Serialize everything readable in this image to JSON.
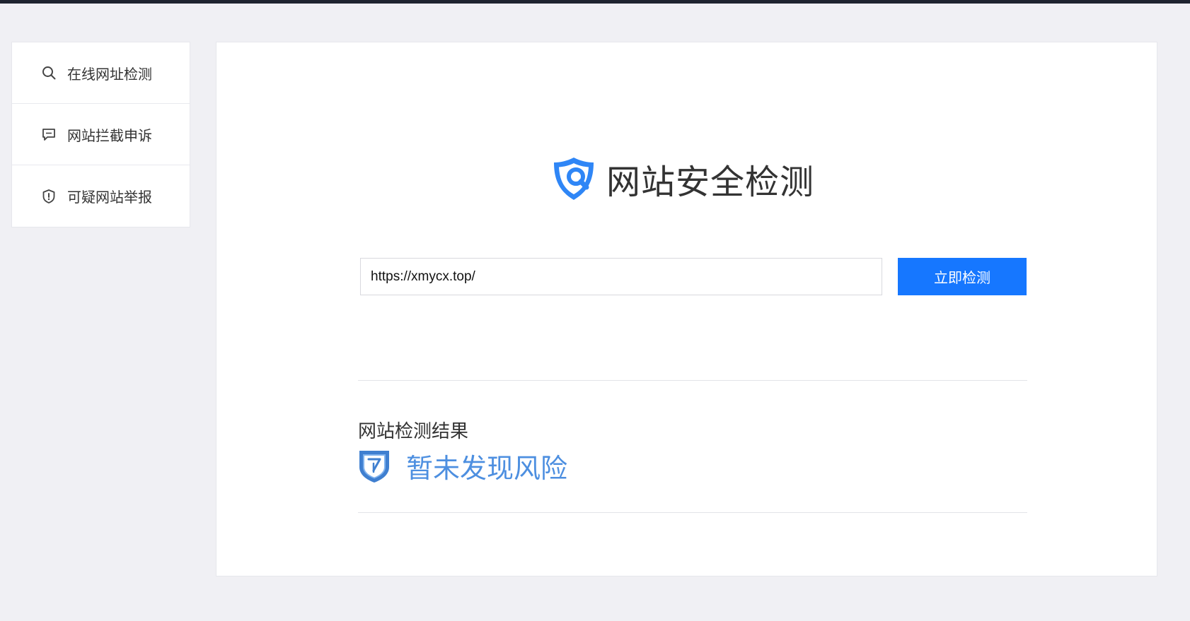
{
  "sidebar": {
    "items": [
      {
        "label": "在线网址检测",
        "icon": "search-icon"
      },
      {
        "label": "网站拦截申诉",
        "icon": "chat-icon"
      },
      {
        "label": "可疑网站举报",
        "icon": "shield-alert-icon"
      }
    ]
  },
  "main": {
    "brand_title": "网站安全检测",
    "search": {
      "value": "https://xmycx.top/",
      "button_label": "立即检测"
    },
    "result": {
      "title": "网站检测结果",
      "status": "暂未发现风险"
    }
  },
  "colors": {
    "accent": "#1677ff",
    "status_text": "#4d8fe0",
    "shield": "#3f7fd0"
  }
}
